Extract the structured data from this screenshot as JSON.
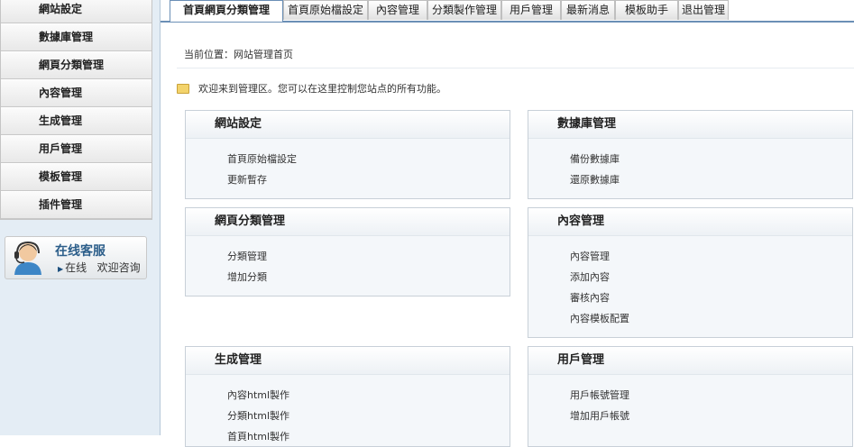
{
  "sidebar": {
    "items": [
      {
        "label": "網站設定"
      },
      {
        "label": "數據庫管理"
      },
      {
        "label": "網頁分類管理"
      },
      {
        "label": "內容管理"
      },
      {
        "label": "生成管理"
      },
      {
        "label": "用戶管理"
      },
      {
        "label": "模板管理"
      },
      {
        "label": "插件管理"
      }
    ],
    "support": {
      "title": "在线客服",
      "status": "在线",
      "message": "欢迎咨询"
    }
  },
  "tabs": [
    {
      "label": "首頁網頁分類管理",
      "active": true
    },
    {
      "label": "首頁原始檔設定"
    },
    {
      "label": "內容管理"
    },
    {
      "label": "分類製作管理"
    },
    {
      "label": "用戶管理"
    },
    {
      "label": "最新消息"
    },
    {
      "label": "模板助手"
    },
    {
      "label": "退出管理"
    }
  ],
  "breadcrumb": "当前位置：网站管理首页",
  "welcome": "欢迎来到管理区。您可以在这里控制您站点的所有功能。",
  "panels": [
    {
      "title": "網站設定",
      "links": [
        "首頁原始檔設定",
        "更新暫存"
      ]
    },
    {
      "title": "數據庫管理",
      "links": [
        "備份數據庫",
        "還原數據庫"
      ]
    },
    {
      "title": "網頁分類管理",
      "links": [
        "分類管理",
        "增加分類"
      ]
    },
    {
      "title": "內容管理",
      "links": [
        "內容管理",
        "添加內容",
        "審核內容",
        "內容模板配置"
      ]
    },
    {
      "title": "生成管理",
      "links": [
        "內容html製作",
        "分類html製作",
        "首頁html製作"
      ]
    },
    {
      "title": "用戶管理",
      "links": [
        "用戶帳號管理",
        "增加用戶帳號"
      ]
    }
  ],
  "colors": {
    "accent": "#6b8fb6",
    "sidebar_bg": "#e4edf5",
    "panel_bg": "#f4f7fa"
  }
}
